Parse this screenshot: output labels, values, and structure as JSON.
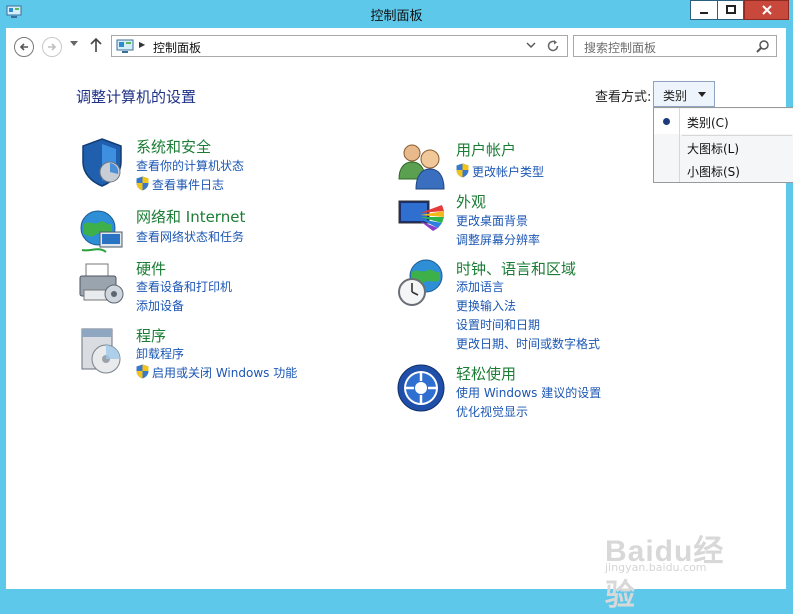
{
  "window": {
    "title": "控制面板",
    "icon": "control-panel-icon",
    "buttons": {
      "minimize": "minimize-icon",
      "maximize": "maximize-icon",
      "close": "close-icon"
    }
  },
  "navigation": {
    "address_path": "控制面板",
    "search_placeholder": "搜索控制面板"
  },
  "main": {
    "heading": "调整计算机的设置",
    "view_by_label": "查看方式:",
    "view_by_value": "类别"
  },
  "categories": {
    "system_security": {
      "title": "系统和安全",
      "links": [
        "查看你的计算机状态",
        "查看事件日志"
      ],
      "icon": "shield-icon"
    },
    "network": {
      "title": "网络和 Internet",
      "links": [
        "查看网络状态和任务"
      ],
      "icon": "globe-network-icon"
    },
    "hardware": {
      "title": "硬件",
      "links": [
        "查看设备和打印机",
        "添加设备"
      ],
      "icon": "printer-icon"
    },
    "programs": {
      "title": "程序",
      "links": [
        "卸载程序",
        "启用或关闭 Windows 功能"
      ],
      "icon": "programs-icon"
    },
    "user_accounts": {
      "title": "用户帐户",
      "links": [
        "更改帐户类型"
      ],
      "icon": "users-icon"
    },
    "appearance": {
      "title": "外观",
      "links": [
        "更改桌面背景",
        "调整屏幕分辨率"
      ],
      "icon": "appearance-icon"
    },
    "clock_region": {
      "title": "时钟、语言和区域",
      "links": [
        "添加语言",
        "更换输入法",
        "设置时间和日期",
        "更改日期、时间或数字格式"
      ],
      "icon": "clock-globe-icon"
    },
    "ease_of_access": {
      "title": "轻松使用",
      "links": [
        "使用 Windows 建议的设置",
        "优化视觉显示"
      ],
      "icon": "ease-of-access-icon"
    }
  },
  "view_menu": {
    "items": [
      "类别(C)",
      "大图标(L)",
      "小图标(S)"
    ],
    "selected": "类别(C)"
  },
  "watermark": {
    "logo": "Baidu经验",
    "url": "jingyan.baidu.com"
  },
  "colors": {
    "frame": "#5ec8ea",
    "category_title": "#1b7d35",
    "link": "#1c57b4",
    "heading": "#1e3287",
    "close": "#c8483c"
  }
}
